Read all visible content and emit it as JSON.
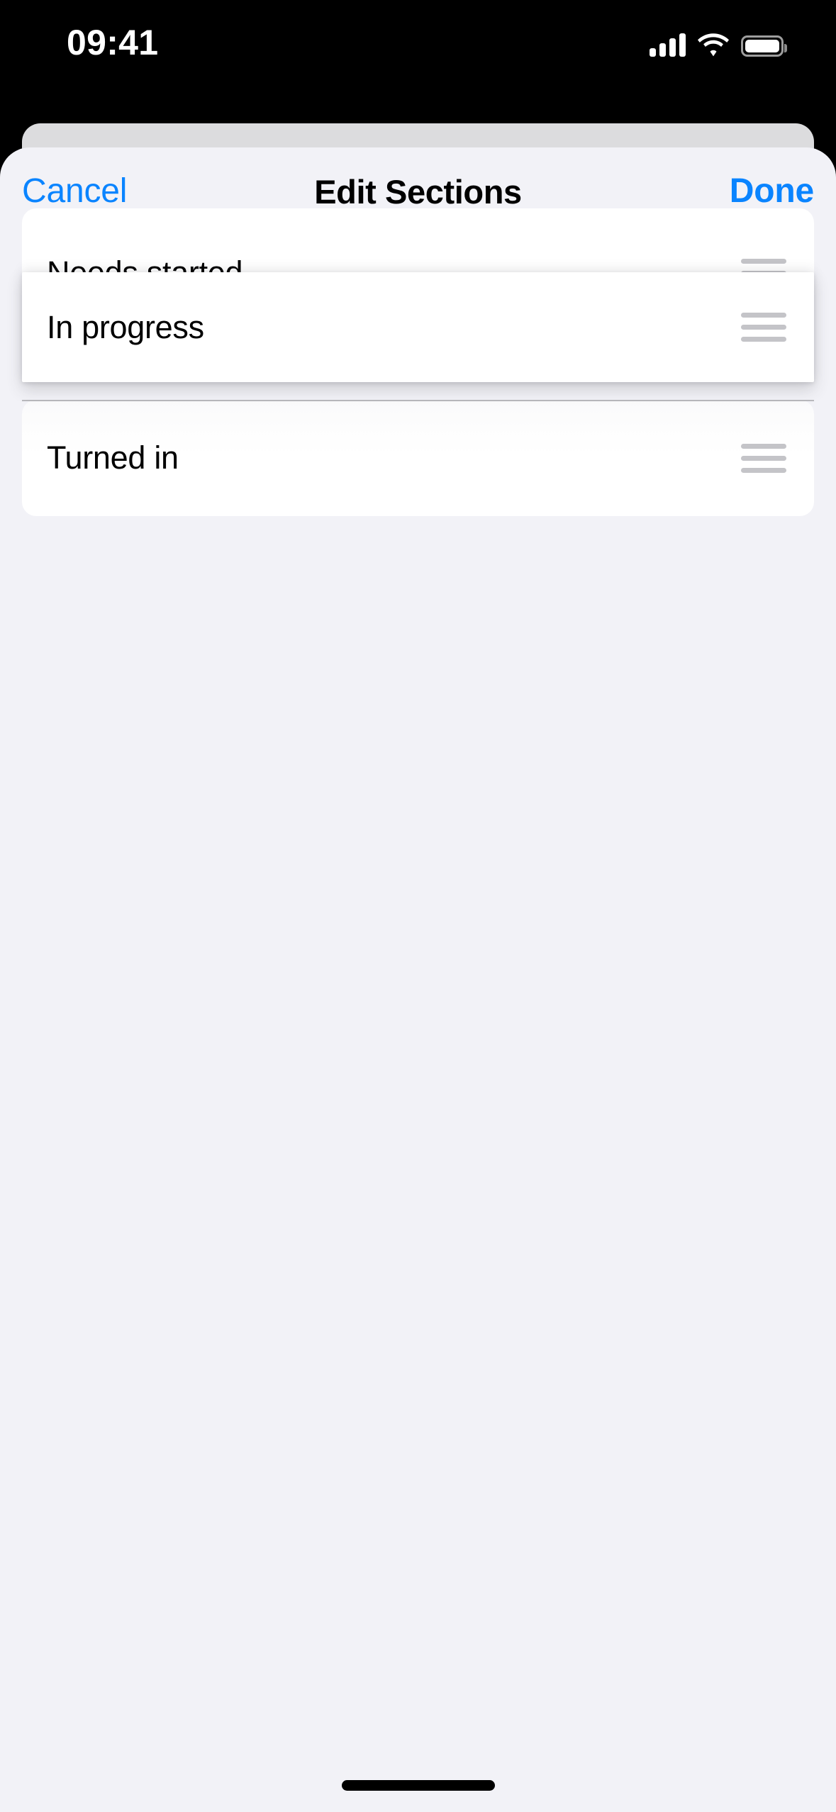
{
  "status_bar": {
    "time": "09:41",
    "cellular_icon": "cellular-signal-icon",
    "cellular_bars_filled": 4,
    "wifi_icon": "wifi-icon",
    "battery_icon": "battery-icon",
    "battery_full": true
  },
  "nav_bar": {
    "cancel_label": "Cancel",
    "title": "Edit Sections",
    "done_label": "Done",
    "tint_color": "#0a84ff",
    "title_color": "#000000"
  },
  "sheet": {
    "background_color": "#f2f2f7",
    "card_color": "#ffffff"
  },
  "section_list": {
    "reorder_icon": "reorder-grip-icon",
    "dragging_index": 1,
    "items": [
      {
        "label": "Needs started",
        "state": "static"
      },
      {
        "label": "In progress",
        "state": "dragging"
      },
      {
        "label": "Turned in",
        "state": "static"
      }
    ]
  },
  "home_indicator": {
    "icon": "home-indicator",
    "color": "#000000"
  }
}
